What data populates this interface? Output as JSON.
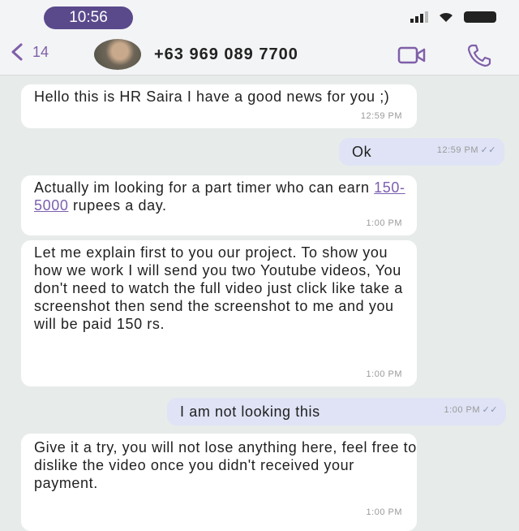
{
  "status": {
    "time": "10:56"
  },
  "header": {
    "back_count": "14",
    "contact": "+63 969 089 7700",
    "icons": [
      "back-chevron-icon",
      "video-call-icon",
      "phone-icon"
    ],
    "accent": "#7f5fa8"
  },
  "messages": [
    {
      "dir": "in",
      "text": "Hello this is HR Saira I have a good news for you ;)",
      "time": "12:59 PM"
    },
    {
      "dir": "out",
      "text": "Ok",
      "time": "12:59 PM",
      "ticks": "✓✓"
    },
    {
      "dir": "in",
      "text_before": "Actually im looking for a part timer who can earn ",
      "link": "150-5000",
      "text_after": " rupees a day.",
      "time": "1:00 PM"
    },
    {
      "dir": "in",
      "text": "Let me explain first to you our project. To show you how we work I will send you two Youtube videos, You don't need to watch the full video just click like take a screenshot then send the screenshot to me and you will be paid 150 rs.",
      "time": "1:00 PM"
    },
    {
      "dir": "out",
      "text": "I am not looking this",
      "time": "1:00 PM",
      "ticks": "✓✓"
    },
    {
      "dir": "in",
      "text": "Give it a try, you will not lose anything here, feel free to dislike the video once you didn't received your payment.",
      "time": "1:00 PM"
    }
  ]
}
